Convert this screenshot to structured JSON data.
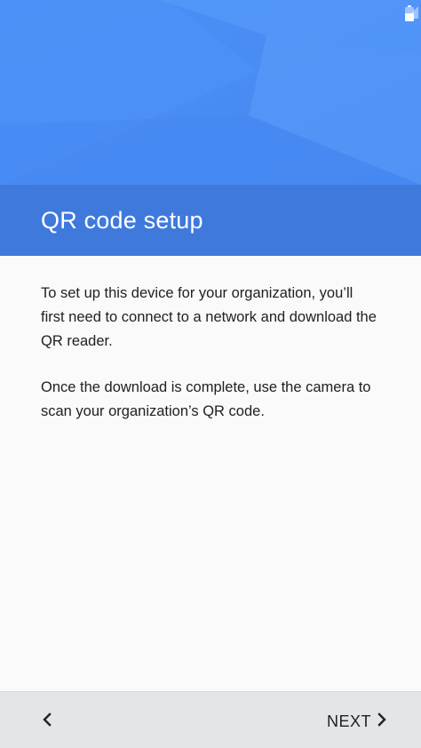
{
  "status_bar": {
    "signal_icon": "cell-signal-icon",
    "battery_icon": "battery-icon"
  },
  "header": {
    "title": "QR code setup"
  },
  "body": {
    "paragraph_1": "To set up this device for your organization, you’ll first need to connect to a network and download the QR reader.",
    "paragraph_2": "Once the download is complete, use the camera to scan your organization’s QR code."
  },
  "nav": {
    "back_icon": "chevron-left-icon",
    "next_label": "NEXT",
    "next_icon": "chevron-right-icon"
  },
  "colors": {
    "hero_blue": "#4a8ef6",
    "title_band": "#3f79dc",
    "body_bg": "#fafafa",
    "nav_bg": "#e3e5e8"
  }
}
